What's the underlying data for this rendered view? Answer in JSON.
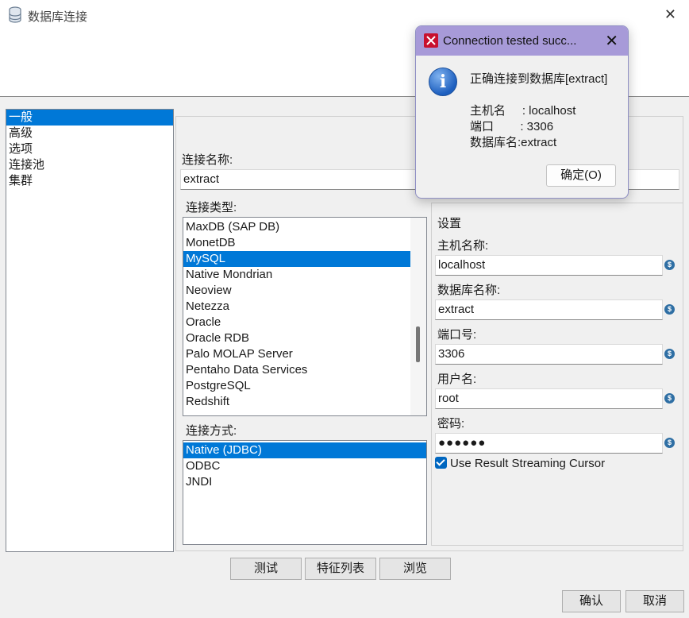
{
  "window": {
    "title": "数据库连接",
    "close_glyph": "✕"
  },
  "nav": {
    "items": [
      {
        "label": "一般",
        "selected": true
      },
      {
        "label": "高级"
      },
      {
        "label": "选项"
      },
      {
        "label": "连接池"
      },
      {
        "label": "集群"
      }
    ]
  },
  "general": {
    "conn_name_label": "连接名称:",
    "conn_name_value": "extract",
    "conn_type_label": "连接类型:",
    "conn_types": [
      "MaxDB (SAP DB)",
      "MonetDB",
      "MySQL",
      "Native Mondrian",
      "Neoview",
      "Netezza",
      "Oracle",
      "Oracle RDB",
      "Palo MOLAP Server",
      "Pentaho Data Services",
      "PostgreSQL",
      "Redshift"
    ],
    "conn_type_selected": "MySQL",
    "access_label": "连接方式:",
    "access_types": [
      "Native (JDBC)",
      "ODBC",
      "JNDI"
    ],
    "access_selected": "Native (JDBC)"
  },
  "settings": {
    "title": "设置",
    "host_label": "主机名称:",
    "host_value": "localhost",
    "db_label": "数据库名称:",
    "db_value": "extract",
    "port_label": "端口号:",
    "port_value": "3306",
    "user_label": "用户名:",
    "user_value": "root",
    "pass_label": "密码:",
    "pass_value": "●●●●●●",
    "streaming_label": "Use Result Streaming Cursor",
    "streaming_checked": true,
    "var_icon": "$"
  },
  "buttons": {
    "test": "测试",
    "features": "特征列表",
    "explore": "浏览",
    "ok": "确认",
    "cancel": "取消"
  },
  "dialog": {
    "title": "Connection tested succ...",
    "close_glyph": "✕",
    "icon": "i",
    "message": "正确连接到数据库[extract]",
    "host_line": "主机名     : localhost",
    "port_line": "端口        : 3306",
    "db_line": "数据库名:extract",
    "ok": "确定(O)"
  },
  "colors": {
    "selection": "#0078d7",
    "dialog_title": "#a79ad8"
  }
}
